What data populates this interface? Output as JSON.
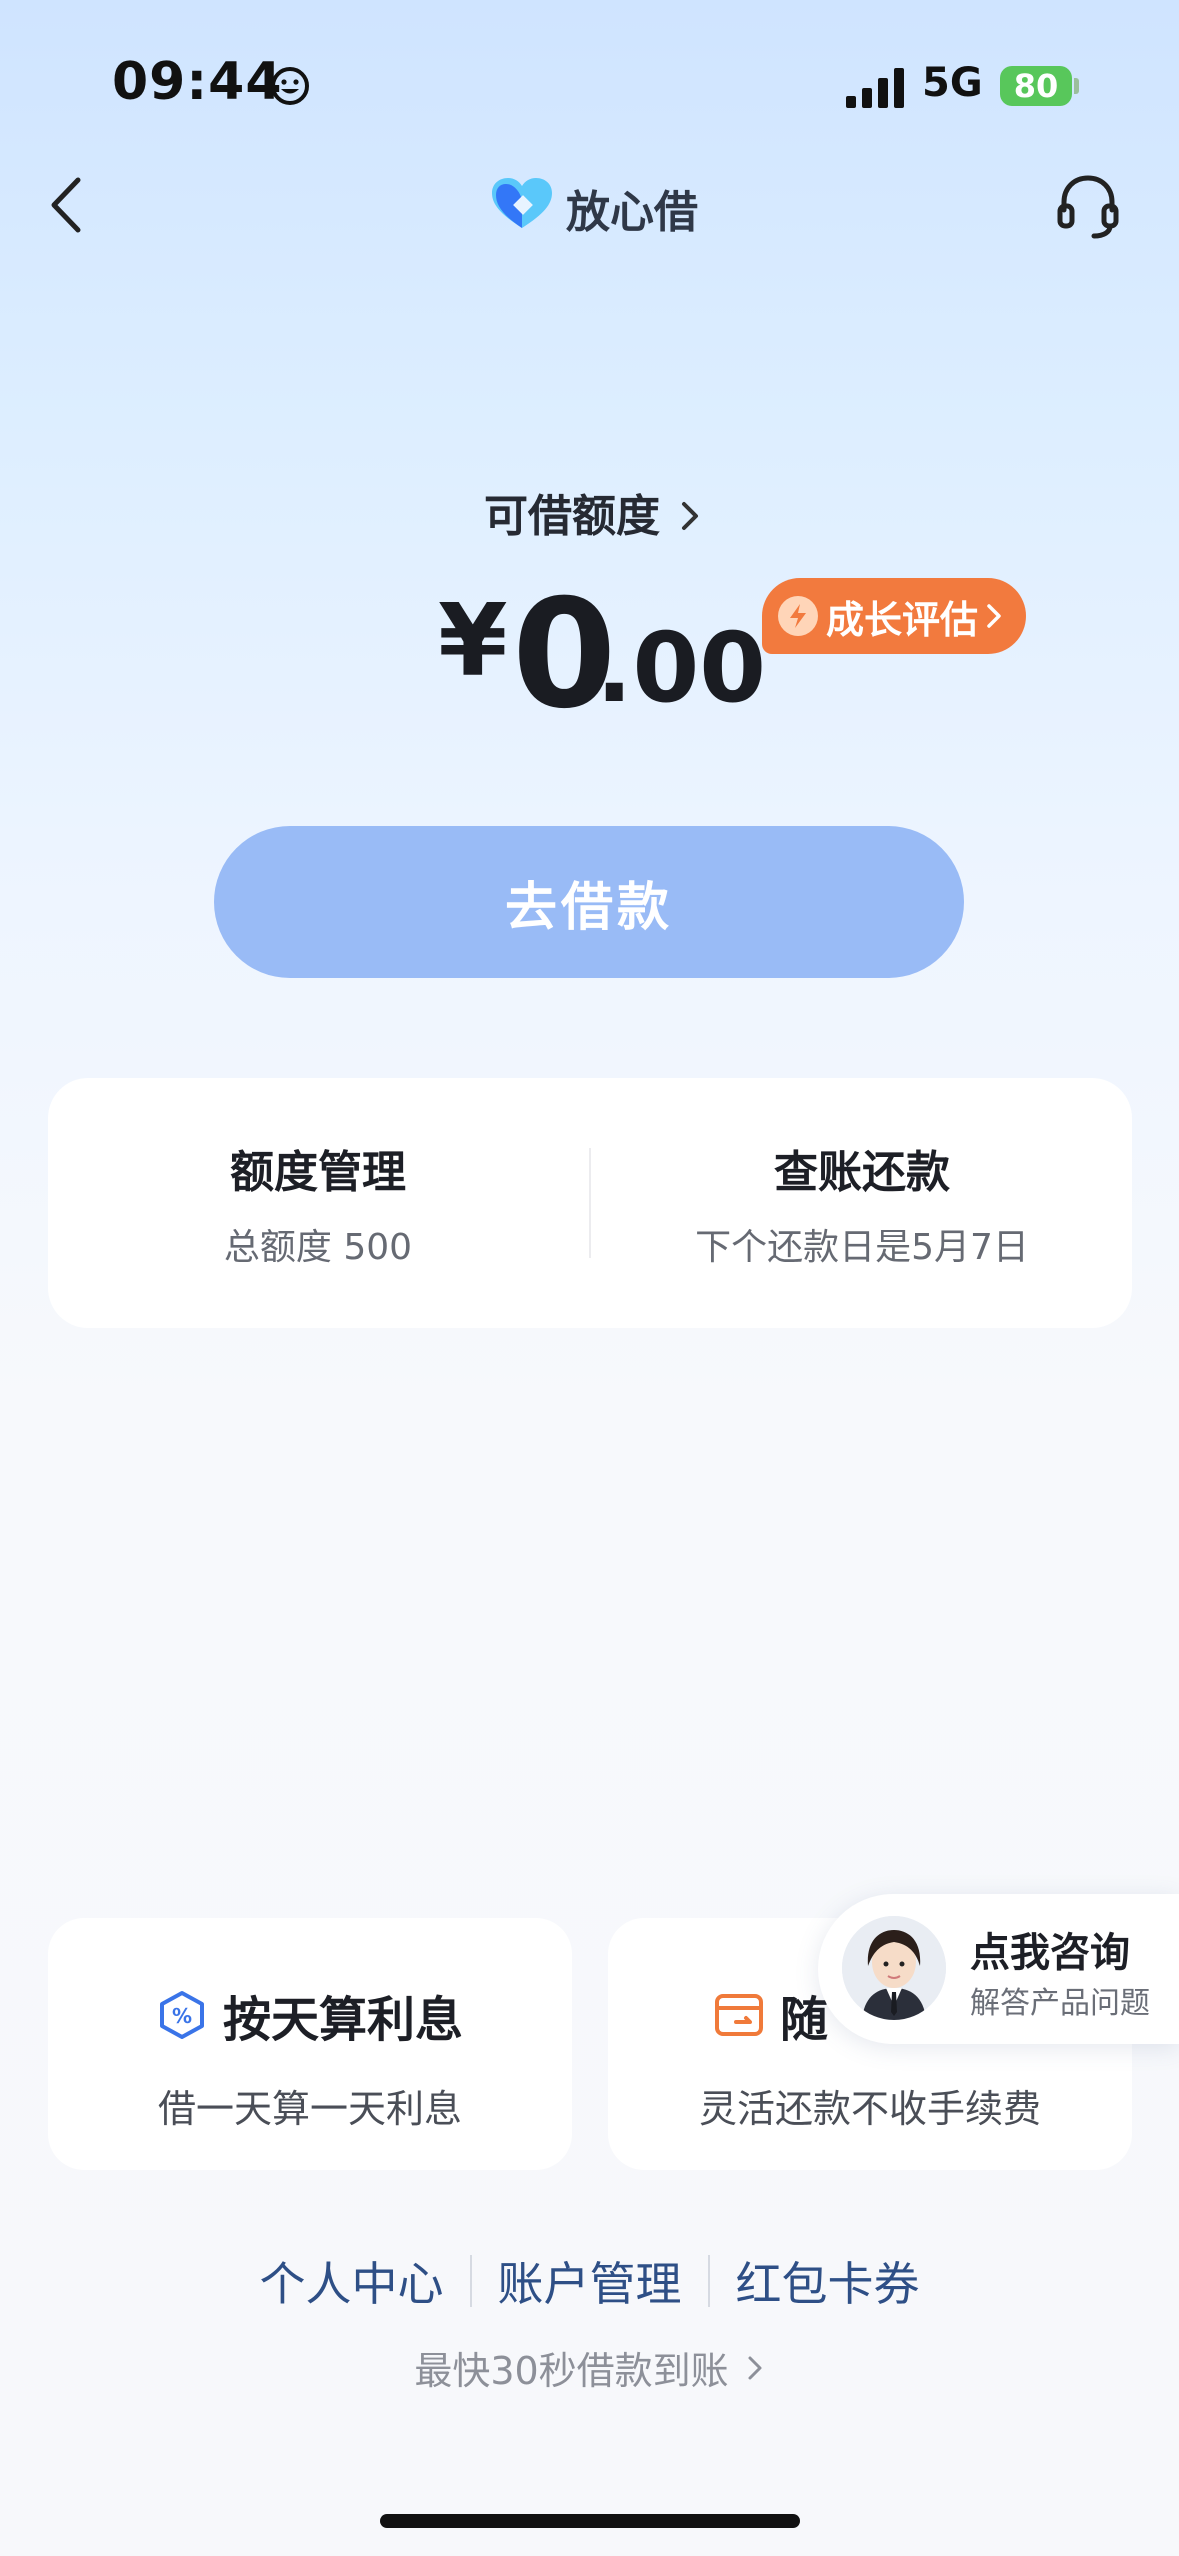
{
  "status_bar": {
    "time": "09:44",
    "network": "5G",
    "battery": "80"
  },
  "nav": {
    "title": "放心借",
    "logo_colors": [
      "#2f6ef6",
      "#5ac8fa"
    ]
  },
  "credit": {
    "label": "可借额度",
    "currency": "¥",
    "amount_int": "0",
    "amount_dec": ".00",
    "growth_badge": "成长评估"
  },
  "borrow_button": {
    "label": "去借款"
  },
  "quick_actions": [
    {
      "title": "额度管理",
      "subtitle": "总额度 500"
    },
    {
      "title": "查账还款",
      "subtitle": "下个还款日是5月7日"
    }
  ],
  "features": [
    {
      "title": "按天算利息",
      "subtitle": "借一天算一天利息",
      "icon": "percent-shield-icon"
    },
    {
      "title": "随",
      "subtitle": "灵活还款不收手续费",
      "icon": "wallet-icon"
    }
  ],
  "consult": {
    "title": "点我咨询",
    "subtitle": "解答产品问题"
  },
  "links": [
    "个人中心",
    "账户管理",
    "红包卡券"
  ],
  "tagline": "最快30秒借款到账",
  "colors": {
    "accent_blue": "#99bbf6",
    "badge_orange": "#f27a3e",
    "link_blue": "#2e4f86"
  }
}
